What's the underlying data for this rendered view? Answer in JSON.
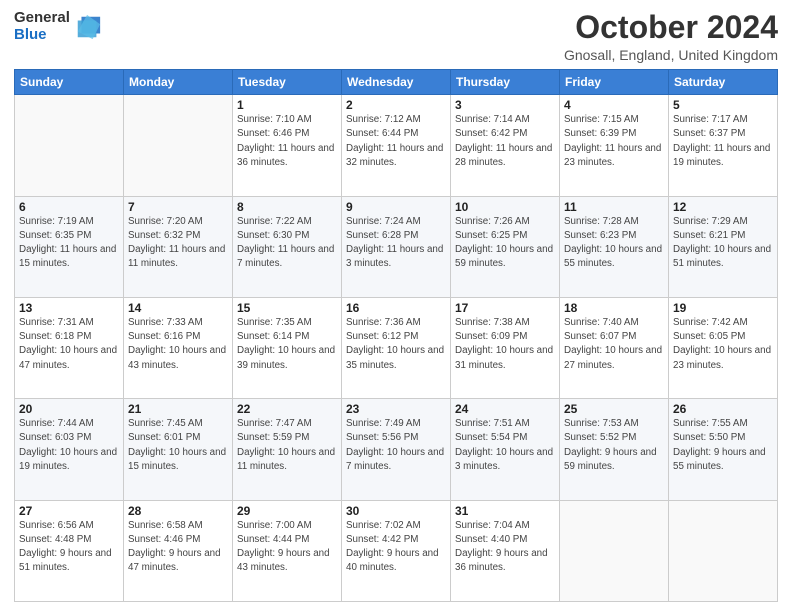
{
  "logo": {
    "general": "General",
    "blue": "Blue"
  },
  "header": {
    "month": "October 2024",
    "location": "Gnosall, England, United Kingdom"
  },
  "weekdays": [
    "Sunday",
    "Monday",
    "Tuesday",
    "Wednesday",
    "Thursday",
    "Friday",
    "Saturday"
  ],
  "weeks": [
    [
      {
        "day": "",
        "info": ""
      },
      {
        "day": "",
        "info": ""
      },
      {
        "day": "1",
        "info": "Sunrise: 7:10 AM\nSunset: 6:46 PM\nDaylight: 11 hours and 36 minutes."
      },
      {
        "day": "2",
        "info": "Sunrise: 7:12 AM\nSunset: 6:44 PM\nDaylight: 11 hours and 32 minutes."
      },
      {
        "day": "3",
        "info": "Sunrise: 7:14 AM\nSunset: 6:42 PM\nDaylight: 11 hours and 28 minutes."
      },
      {
        "day": "4",
        "info": "Sunrise: 7:15 AM\nSunset: 6:39 PM\nDaylight: 11 hours and 23 minutes."
      },
      {
        "day": "5",
        "info": "Sunrise: 7:17 AM\nSunset: 6:37 PM\nDaylight: 11 hours and 19 minutes."
      }
    ],
    [
      {
        "day": "6",
        "info": "Sunrise: 7:19 AM\nSunset: 6:35 PM\nDaylight: 11 hours and 15 minutes."
      },
      {
        "day": "7",
        "info": "Sunrise: 7:20 AM\nSunset: 6:32 PM\nDaylight: 11 hours and 11 minutes."
      },
      {
        "day": "8",
        "info": "Sunrise: 7:22 AM\nSunset: 6:30 PM\nDaylight: 11 hours and 7 minutes."
      },
      {
        "day": "9",
        "info": "Sunrise: 7:24 AM\nSunset: 6:28 PM\nDaylight: 11 hours and 3 minutes."
      },
      {
        "day": "10",
        "info": "Sunrise: 7:26 AM\nSunset: 6:25 PM\nDaylight: 10 hours and 59 minutes."
      },
      {
        "day": "11",
        "info": "Sunrise: 7:28 AM\nSunset: 6:23 PM\nDaylight: 10 hours and 55 minutes."
      },
      {
        "day": "12",
        "info": "Sunrise: 7:29 AM\nSunset: 6:21 PM\nDaylight: 10 hours and 51 minutes."
      }
    ],
    [
      {
        "day": "13",
        "info": "Sunrise: 7:31 AM\nSunset: 6:18 PM\nDaylight: 10 hours and 47 minutes."
      },
      {
        "day": "14",
        "info": "Sunrise: 7:33 AM\nSunset: 6:16 PM\nDaylight: 10 hours and 43 minutes."
      },
      {
        "day": "15",
        "info": "Sunrise: 7:35 AM\nSunset: 6:14 PM\nDaylight: 10 hours and 39 minutes."
      },
      {
        "day": "16",
        "info": "Sunrise: 7:36 AM\nSunset: 6:12 PM\nDaylight: 10 hours and 35 minutes."
      },
      {
        "day": "17",
        "info": "Sunrise: 7:38 AM\nSunset: 6:09 PM\nDaylight: 10 hours and 31 minutes."
      },
      {
        "day": "18",
        "info": "Sunrise: 7:40 AM\nSunset: 6:07 PM\nDaylight: 10 hours and 27 minutes."
      },
      {
        "day": "19",
        "info": "Sunrise: 7:42 AM\nSunset: 6:05 PM\nDaylight: 10 hours and 23 minutes."
      }
    ],
    [
      {
        "day": "20",
        "info": "Sunrise: 7:44 AM\nSunset: 6:03 PM\nDaylight: 10 hours and 19 minutes."
      },
      {
        "day": "21",
        "info": "Sunrise: 7:45 AM\nSunset: 6:01 PM\nDaylight: 10 hours and 15 minutes."
      },
      {
        "day": "22",
        "info": "Sunrise: 7:47 AM\nSunset: 5:59 PM\nDaylight: 10 hours and 11 minutes."
      },
      {
        "day": "23",
        "info": "Sunrise: 7:49 AM\nSunset: 5:56 PM\nDaylight: 10 hours and 7 minutes."
      },
      {
        "day": "24",
        "info": "Sunrise: 7:51 AM\nSunset: 5:54 PM\nDaylight: 10 hours and 3 minutes."
      },
      {
        "day": "25",
        "info": "Sunrise: 7:53 AM\nSunset: 5:52 PM\nDaylight: 9 hours and 59 minutes."
      },
      {
        "day": "26",
        "info": "Sunrise: 7:55 AM\nSunset: 5:50 PM\nDaylight: 9 hours and 55 minutes."
      }
    ],
    [
      {
        "day": "27",
        "info": "Sunrise: 6:56 AM\nSunset: 4:48 PM\nDaylight: 9 hours and 51 minutes."
      },
      {
        "day": "28",
        "info": "Sunrise: 6:58 AM\nSunset: 4:46 PM\nDaylight: 9 hours and 47 minutes."
      },
      {
        "day": "29",
        "info": "Sunrise: 7:00 AM\nSunset: 4:44 PM\nDaylight: 9 hours and 43 minutes."
      },
      {
        "day": "30",
        "info": "Sunrise: 7:02 AM\nSunset: 4:42 PM\nDaylight: 9 hours and 40 minutes."
      },
      {
        "day": "31",
        "info": "Sunrise: 7:04 AM\nSunset: 4:40 PM\nDaylight: 9 hours and 36 minutes."
      },
      {
        "day": "",
        "info": ""
      },
      {
        "day": "",
        "info": ""
      }
    ]
  ]
}
